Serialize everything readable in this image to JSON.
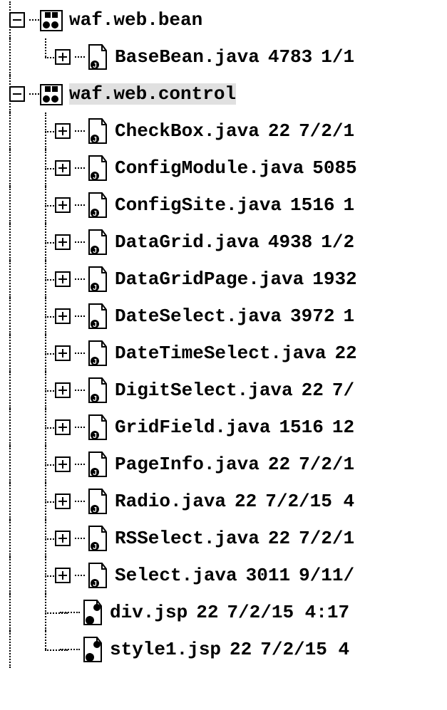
{
  "tree": {
    "packages": [
      {
        "name": "waf.web.bean",
        "expanded": true,
        "icon": "package-icon",
        "files": [
          {
            "name": "BaseBean.java",
            "size": "4783",
            "date": "1/1",
            "icon": "java-file-icon",
            "expandable": true
          }
        ]
      },
      {
        "name": "waf.web.control",
        "expanded": true,
        "selected": true,
        "icon": "package-icon",
        "files": [
          {
            "name": "CheckBox.java",
            "size": "22",
            "date": "7/2/1",
            "icon": "java-file-icon",
            "expandable": true
          },
          {
            "name": "ConfigModule.java",
            "size": "5085",
            "date": "",
            "icon": "java-file-icon",
            "expandable": true
          },
          {
            "name": "ConfigSite.java",
            "size": "1516",
            "date": "1",
            "icon": "java-file-icon",
            "expandable": true
          },
          {
            "name": "DataGrid.java",
            "size": "4938",
            "date": "1/2",
            "icon": "java-file-icon",
            "expandable": true
          },
          {
            "name": "DataGridPage.java",
            "size": "1932",
            "date": "",
            "icon": "java-file-icon",
            "expandable": true
          },
          {
            "name": "DateSelect.java",
            "size": "3972",
            "date": "1",
            "icon": "java-file-icon",
            "expandable": true
          },
          {
            "name": "DateTimeSelect.java",
            "size": "22",
            "date": "",
            "icon": "java-file-icon",
            "expandable": true
          },
          {
            "name": "DigitSelect.java",
            "size": "22",
            "date": "7/",
            "icon": "java-file-icon",
            "expandable": true
          },
          {
            "name": "GridField.java",
            "size": "1516",
            "date": "12",
            "icon": "java-file-icon",
            "expandable": true
          },
          {
            "name": "PageInfo.java",
            "size": "22",
            "date": "7/2/1",
            "icon": "java-file-icon",
            "expandable": true
          },
          {
            "name": "Radio.java",
            "size": "22",
            "date": "7/2/15 4",
            "icon": "java-file-icon",
            "expandable": true
          },
          {
            "name": "RSSelect.java",
            "size": "22",
            "date": "7/2/1",
            "icon": "java-file-icon",
            "expandable": true
          },
          {
            "name": "Select.java",
            "size": "3011",
            "date": "9/11/",
            "icon": "java-file-icon",
            "expandable": true
          },
          {
            "name": "div.jsp",
            "size": "22",
            "date": "7/2/15 4:17",
            "icon": "jsp-file-icon",
            "expandable": false
          },
          {
            "name": "style1.jsp",
            "size": "22",
            "date": "7/2/15 4",
            "icon": "jsp-file-icon",
            "expandable": false
          }
        ]
      }
    ]
  }
}
